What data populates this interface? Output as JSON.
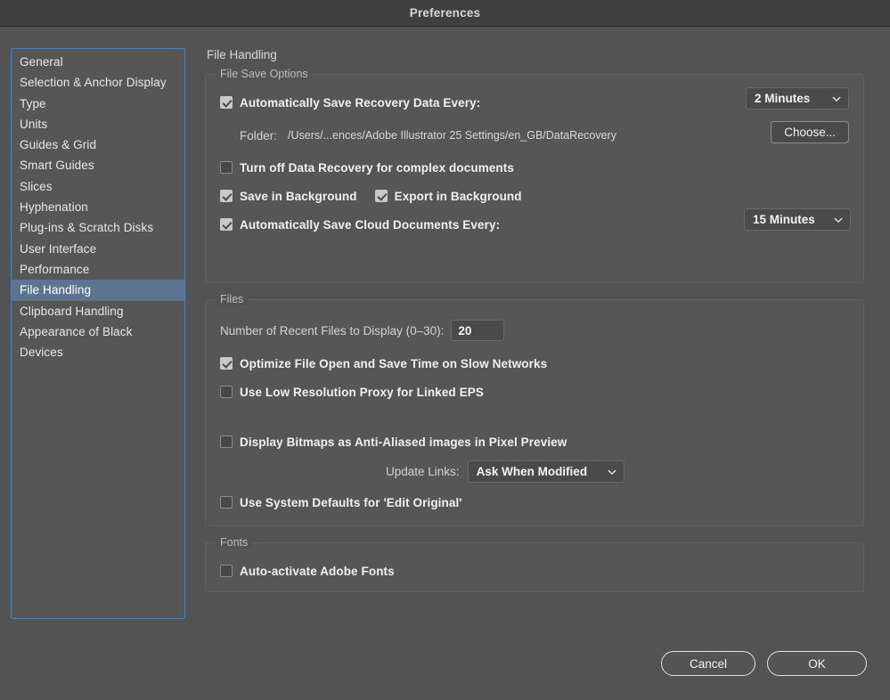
{
  "window": {
    "title": "Preferences"
  },
  "sidebar": {
    "items": [
      {
        "label": "General",
        "selected": false
      },
      {
        "label": "Selection & Anchor Display",
        "selected": false
      },
      {
        "label": "Type",
        "selected": false
      },
      {
        "label": "Units",
        "selected": false
      },
      {
        "label": "Guides & Grid",
        "selected": false
      },
      {
        "label": "Smart Guides",
        "selected": false
      },
      {
        "label": "Slices",
        "selected": false
      },
      {
        "label": "Hyphenation",
        "selected": false
      },
      {
        "label": "Plug-ins & Scratch Disks",
        "selected": false
      },
      {
        "label": "User Interface",
        "selected": false
      },
      {
        "label": "Performance",
        "selected": false
      },
      {
        "label": "File Handling",
        "selected": true
      },
      {
        "label": "Clipboard Handling",
        "selected": false
      },
      {
        "label": "Appearance of Black",
        "selected": false
      },
      {
        "label": "Devices",
        "selected": false
      }
    ]
  },
  "pane": {
    "title": "File Handling",
    "file_save_options": {
      "legend": "File Save Options",
      "auto_save_recovery_label": "Automatically Save Recovery Data Every:",
      "auto_save_recovery_checked": true,
      "recovery_interval": "2 Minutes",
      "folder_label": "Folder:",
      "folder_path": "/Users/...ences/Adobe Illustrator 25 Settings/en_GB/DataRecovery",
      "choose_button": "Choose...",
      "turn_off_recovery_label": "Turn off Data Recovery for complex documents",
      "turn_off_recovery_checked": false,
      "save_in_background_label": "Save in Background",
      "save_in_background_checked": true,
      "export_in_background_label": "Export in Background",
      "export_in_background_checked": true,
      "auto_save_cloud_label": "Automatically Save Cloud Documents Every:",
      "auto_save_cloud_checked": true,
      "cloud_interval": "15 Minutes"
    },
    "files": {
      "legend": "Files",
      "recent_files_label": "Number of Recent Files to Display (0–30):",
      "recent_files_value": "20",
      "optimize_label": "Optimize File Open and Save Time on Slow Networks",
      "optimize_checked": true,
      "low_res_proxy_label": "Use Low Resolution Proxy for Linked EPS",
      "low_res_proxy_checked": false,
      "display_bitmaps_label": "Display Bitmaps as Anti-Aliased images in Pixel Preview",
      "display_bitmaps_checked": false,
      "update_links_label": "Update Links:",
      "update_links_value": "Ask When Modified",
      "edit_original_label": "Use System Defaults for 'Edit Original'",
      "edit_original_checked": false
    },
    "fonts": {
      "legend": "Fonts",
      "auto_activate_label": "Auto-activate Adobe Fonts",
      "auto_activate_checked": false
    }
  },
  "footer": {
    "cancel_label": "Cancel",
    "ok_label": "OK"
  },
  "colors": {
    "window_bg": "#535353",
    "titlebar_bg": "#3f3f3f",
    "group_bg": "#565656",
    "focus_border": "#2e8ae6",
    "selection_bg": "#5d7490",
    "control_bg": "#4a4a4a",
    "text_primary": "#f0f0f0",
    "text_secondary": "#bdbdbd"
  }
}
